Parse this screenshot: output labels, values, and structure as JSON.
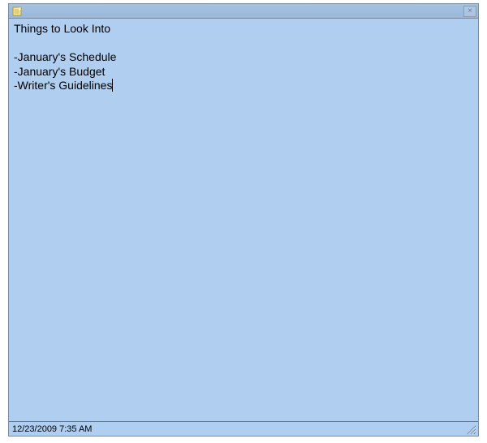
{
  "titlebar": {
    "app_icon": "sticky-note-icon",
    "close_label": "×"
  },
  "note": {
    "title": "Things to Look Into",
    "lines": [
      "-January's Schedule",
      "-January's Budget",
      "-Writer's Guidelines"
    ]
  },
  "statusbar": {
    "timestamp": "12/23/2009 7:35 AM"
  }
}
